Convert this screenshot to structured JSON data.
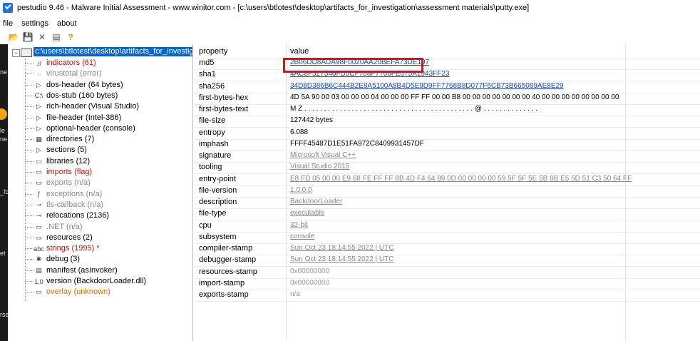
{
  "window": {
    "title": "pestudio 9.46 - Malware Initial Assessment - www.winitor.com - [c:\\users\\btlotest\\desktop\\artifacts_for_investigation\\assessment materials\\putty.exe]"
  },
  "menu": [
    "file",
    "settings",
    "about"
  ],
  "toolbar": {
    "icons": [
      "open-folder-icon",
      "save-icon",
      "close-x-icon",
      "list-icon",
      "help-icon"
    ],
    "glyphs": [
      "📂",
      "💾",
      "✕",
      "▤",
      "?"
    ]
  },
  "left_strip": {
    "fragments": [
      "ne",
      "le",
      "ne",
      "_fc",
      "et",
      "rse"
    ]
  },
  "tree": {
    "root": "c:\\users\\btlotest\\desktop\\artifacts_for_investigat",
    "items": [
      {
        "label": "indicators (61)",
        "style": "red",
        "icon": ".ıl"
      },
      {
        "label": "virustotal (error)",
        "style": "gray",
        "icon": "◌"
      },
      {
        "label": "dos-header (64 bytes)",
        "style": "normal",
        "icon": "▷"
      },
      {
        "label": "dos-stub (160 bytes)",
        "style": "normal",
        "icon": "C:\\"
      },
      {
        "label": "rich-header (Visual Studio)",
        "style": "normal",
        "icon": "▷"
      },
      {
        "label": "file-header (Intel-386)",
        "style": "normal",
        "icon": "▷"
      },
      {
        "label": "optional-header (console)",
        "style": "normal",
        "icon": "▷"
      },
      {
        "label": "directories (7)",
        "style": "normal",
        "icon": "▦"
      },
      {
        "label": "sections (5)",
        "style": "normal",
        "icon": "▷"
      },
      {
        "label": "libraries (12)",
        "style": "normal",
        "icon": "▭"
      },
      {
        "label": "imports (flag)",
        "style": "red",
        "icon": "▭"
      },
      {
        "label": "exports (n/a)",
        "style": "gray",
        "icon": "▭"
      },
      {
        "label": "exceptions (n/a)",
        "style": "gray",
        "icon": "ƒ"
      },
      {
        "label": "tls-callback (n/a)",
        "style": "gray",
        "icon": "⊸"
      },
      {
        "label": "relocations (2136)",
        "style": "normal",
        "icon": "⊸"
      },
      {
        "label": ".NET (n/a)",
        "style": "gray",
        "icon": "▭"
      },
      {
        "label": "resources (2)",
        "style": "normal",
        "icon": "▭"
      },
      {
        "label": "strings (1995) *",
        "style": "red",
        "icon": "abc"
      },
      {
        "label": "debug (3)",
        "style": "normal",
        "icon": "✱"
      },
      {
        "label": "manifest (asInvoker)",
        "style": "normal",
        "icon": "▤"
      },
      {
        "label": "version (BackdoorLoader.dll)",
        "style": "normal",
        "icon": "1.0"
      },
      {
        "label": "overlay (unknown)",
        "style": "orange",
        "icon": "▭"
      }
    ]
  },
  "table": {
    "headers": {
      "property": "property",
      "value": "value"
    },
    "rows": [
      {
        "property": "md5",
        "value": "2B06DD8ADA98F0020AA20BEFA73DE197",
        "style": "link"
      },
      {
        "property": "sha1",
        "value": "4AC8F527546FD5CF768F7766FE075A1943FF23",
        "style": "link"
      },
      {
        "property": "sha256",
        "value": "34D8D386B6C444B2E8A5100A8B4D5E9D9FF7768B8D077F6CB73B665089AE8E29",
        "style": "link"
      },
      {
        "property": "first-bytes-hex",
        "value": "4D 5A 90 00 03 00 00 00 04 00 00 00 FF FF 00 00 B8 00 00 00 00 00 00 00 40 00 00 00 00 00 00 00 00",
        "style": "plain"
      },
      {
        "property": "first-bytes-text",
        "value": "M Z . . . . . . . . . . . . . . . . . . . . . . . . . . . . . . . . . . . . . . . . . . . @ . . . . . . . . . . . . . .",
        "style": "plain"
      },
      {
        "property": "file-size",
        "value": "127442 bytes",
        "style": "plain"
      },
      {
        "property": "entropy",
        "value": "6.088",
        "style": "plain"
      },
      {
        "property": "imphash",
        "value": "FFFF45487D1E51FA972C8409931457DF",
        "style": "plain"
      },
      {
        "property": "signature",
        "value": "Microsoft Visual C++",
        "style": "grayu"
      },
      {
        "property": "tooling",
        "value": "Visual Studio 2015",
        "style": "grayu"
      },
      {
        "property": "entry-point",
        "value": "E8 FD 05 00 00 E9 68 FE FF FF 8B 4D F4 64 89 0D 00 00 00 00 59 5F 5F 5E 5B 8B E5 5D 51 C3 50 64 FF",
        "style": "grayu"
      },
      {
        "property": "file-version",
        "value": "1.0.0.0",
        "style": "grayu"
      },
      {
        "property": "description",
        "value": "BackdoorLoader",
        "style": "grayu"
      },
      {
        "property": "file-type",
        "value": "executable",
        "style": "grayu"
      },
      {
        "property": "cpu",
        "value": "32-bit",
        "style": "grayu"
      },
      {
        "property": "subsystem",
        "value": "console",
        "style": "grayu"
      },
      {
        "property": "compiler-stamp",
        "value": "Sun Oct 23 18:14:55 2022 | UTC",
        "style": "grayu"
      },
      {
        "property": "debugger-stamp",
        "value": "Sun Oct 23 18:14:55 2022 | UTC",
        "style": "grayu"
      },
      {
        "property": "resources-stamp",
        "value": "0x00000000",
        "style": "grayval"
      },
      {
        "property": "import-stamp",
        "value": "0x00000000",
        "style": "grayval"
      },
      {
        "property": "exports-stamp",
        "value": "n/a",
        "style": "grayval"
      }
    ]
  },
  "colors": {
    "selection": "#0a64c9",
    "highlight_box": "#e01010",
    "link": "#1a44d0",
    "red_text": "#d01010",
    "orange_text": "#e07000"
  }
}
